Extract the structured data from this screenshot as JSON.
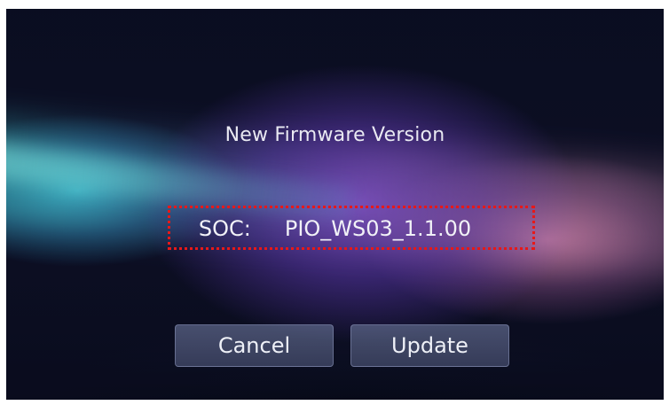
{
  "dialog": {
    "title": "New Firmware Version",
    "soc_label": "SOC:",
    "soc_version": "PIO_WS03_1.1.00"
  },
  "buttons": {
    "cancel_label": "Cancel",
    "update_label": "Update"
  },
  "colors": {
    "highlight_border": "#e81818",
    "background_dark": "#0c1430",
    "text": "#eef0f7"
  }
}
